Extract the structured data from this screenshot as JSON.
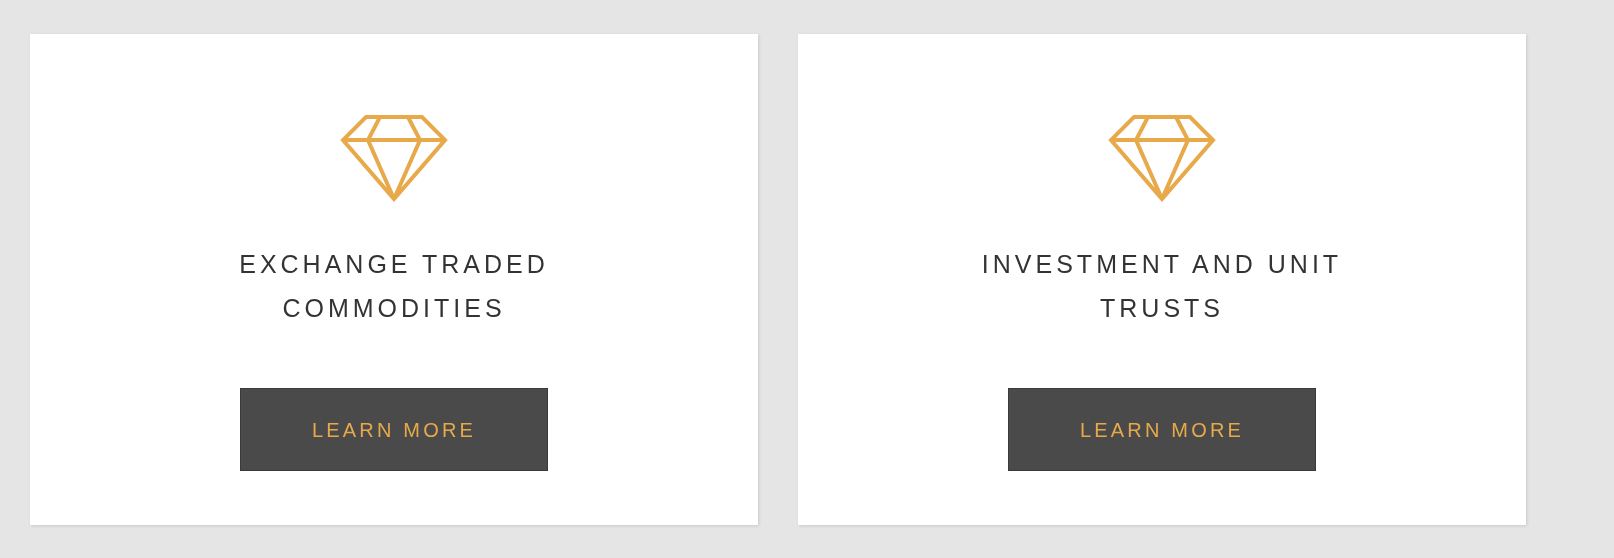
{
  "cards": [
    {
      "title": "EXCHANGE TRADED COMMODITIES",
      "button": "LEARN MORE"
    },
    {
      "title": "INVESTMENT AND UNIT TRUSTS",
      "button": "LEARN MORE"
    }
  ]
}
